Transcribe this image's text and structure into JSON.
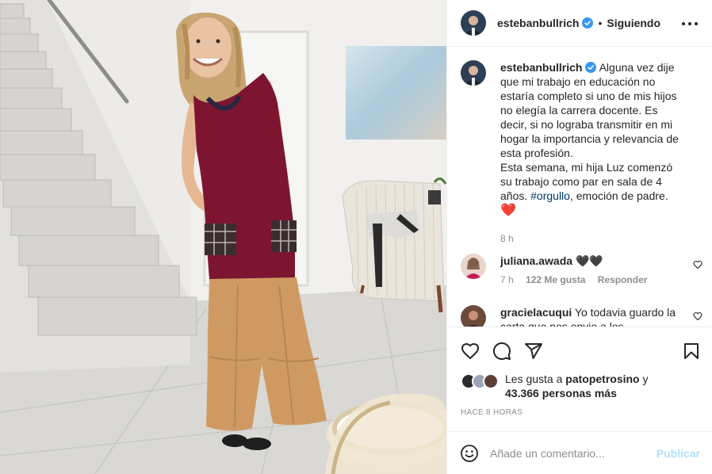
{
  "post": {
    "author": "estebanbullrich",
    "follow_status": "Siguiendo",
    "separator": "•"
  },
  "caption": {
    "author": "estebanbullrich",
    "line1": "Alguna vez dije",
    "line2": "que mi trabajo en educación no",
    "line3": "estaría completo si uno de mis hijos",
    "line4": "no elegía la carrera docente. Es",
    "line5": "decir, si no lograba transmitir en mi",
    "line6": "hogar la importancia y relevancia de",
    "line7": "esta profesión.",
    "line8": "Esta semana, mi hija Luz comenzó",
    "line9": "su trabajo como par en sala de 4",
    "line10_pre": "años. ",
    "hashtag": "#orgullo",
    "line10_post": ", emoción de padre.",
    "emoji": "❤️",
    "time": "8 h"
  },
  "comments": [
    {
      "user": "juliana.awada",
      "text": "🖤🖤",
      "time": "7 h",
      "likes": "122 Me gusta",
      "reply": "Responder"
    },
    {
      "user": "gracielacuqui",
      "text": "Yo todavia guardo la carta que nos envio a los"
    }
  ],
  "likes": {
    "prefix": "Les gusta a ",
    "user": "patopetrosino",
    "suffix": " y",
    "others": "43.366 personas más"
  },
  "timestamp": "HACE 8 HORAS",
  "add_comment": {
    "placeholder": "Añade un comentario...",
    "publish": "Publicar"
  },
  "colors": {
    "verified": "#3897f0",
    "link": "#00376b",
    "publish_disabled": "#b2dffc",
    "meta": "#8e8e8e"
  }
}
